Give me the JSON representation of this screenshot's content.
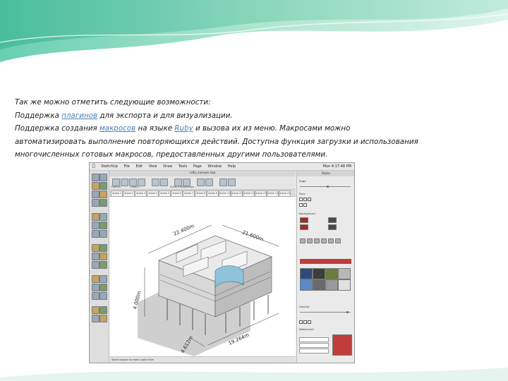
{
  "slide": {
    "line1": "Так же можно отметить следующие возможности:",
    "line2_pre": "Поддержка ",
    "line2_link": "плагинов",
    "line2_post": " для экспорта и для визуализации.",
    "line3_pre": "Поддержка создания ",
    "line3_link1": "макросов",
    "line3_mid": " на языке ",
    "line3_link2": "Ruby",
    "line3_post": " и вызова их из меню. Макросами можно",
    "line4": "автоматизировать выполнение повторяющихся действий. Доступна функция загрузки и использования",
    "line5": "многочисленных готовых макросов, предоставленных другими пользователями."
  },
  "screenshot": {
    "menu": {
      "apple": "",
      "items": [
        "SketchUp",
        "File",
        "Edit",
        "View",
        "Draw",
        "Tools",
        "Page",
        "Window",
        "Help"
      ],
      "clock": "Mon 4:17:48 PM"
    },
    "window_title": "villa_savoye.skp",
    "toolbar_labels": [
      "Outliner",
      "Layers",
      "Entity Info",
      "Materials"
    ],
    "tabs": [
      "Scene 1",
      "Scene 2",
      "Scene 3",
      "Scene 4",
      "Scene 5",
      "Scene 6",
      "Scene 7",
      "Scene 8",
      "Scene 9",
      "Scene 10",
      "Scene 11",
      "Scene 12",
      "Scene 13",
      "Scene 14",
      "Scene 15"
    ],
    "dimensions": [
      "22.400m",
      "21.600m",
      "4.000m",
      "4.612m",
      "19.264m"
    ],
    "status_text": "Select object to match paint from",
    "panel": {
      "title": "Styles",
      "headers": [
        "Edge",
        "Face",
        "Background",
        "Watermark"
      ],
      "selected_color": "#c03c3c",
      "swatches": [
        "#2e4a7a",
        "#3d3d3d",
        "#6c7c3a",
        "#b8b8b8",
        "#5a8ac8",
        "#6a6a6a",
        "#9a9a9a",
        "#e0e0e0"
      ],
      "opacity_label": "Opacity"
    }
  }
}
